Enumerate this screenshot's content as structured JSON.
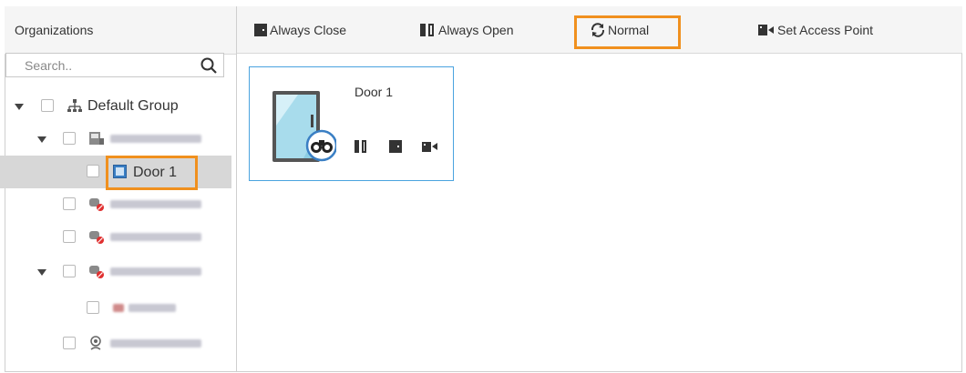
{
  "left_panel": {
    "header": "Organizations",
    "search_placeholder": "Search.."
  },
  "tree": [
    {
      "label": "Default Group",
      "type": "group"
    },
    {
      "label": "",
      "type": "device-blurred"
    },
    {
      "label": "Door 1",
      "type": "door",
      "selected": true
    },
    {
      "label": "",
      "type": "offline-device-blurred"
    },
    {
      "label": "",
      "type": "offline-device-blurred"
    },
    {
      "label": "",
      "type": "offline-device-blurred"
    },
    {
      "label": "",
      "type": "channel-blurred"
    },
    {
      "label": "",
      "type": "camera-blurred"
    }
  ],
  "toolbar": {
    "always_close": "Always Close",
    "always_open": "Always Open",
    "normal": "Normal",
    "set_access_point": "Set Access Point"
  },
  "door_card": {
    "title": "Door 1"
  },
  "colors": {
    "highlight": "#f0901e",
    "card_border": "#4aa3df",
    "selected_row": "#d7d7d7"
  }
}
